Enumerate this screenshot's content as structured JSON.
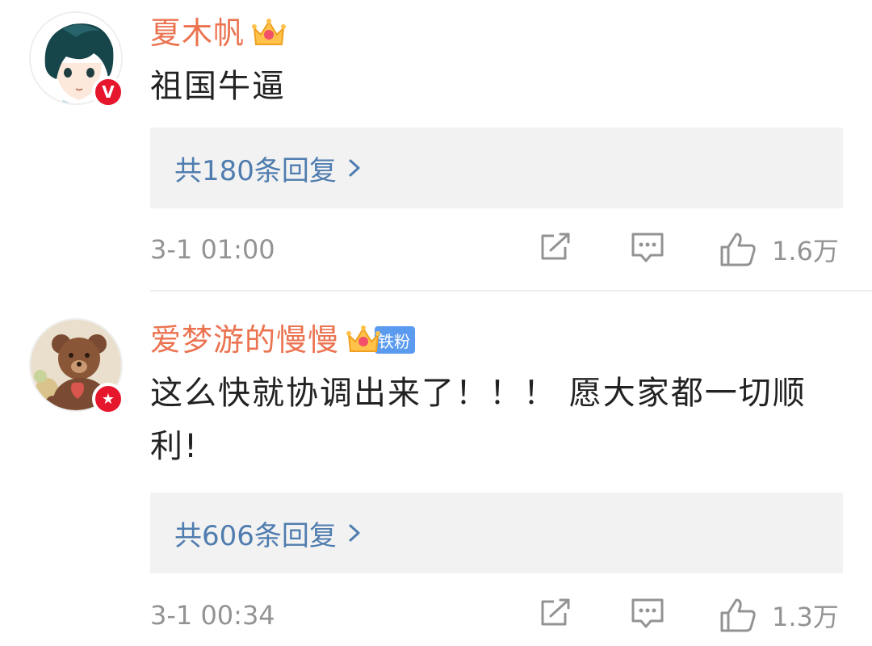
{
  "comments": [
    {
      "username": "夏木帆",
      "badge_icon": "verified-v-icon",
      "crown_icon": "crown-icon",
      "content": "祖国牛逼",
      "reply_summary": "共180条回复",
      "timestamp": "3-1 01:00",
      "like_count": "1.6万"
    },
    {
      "username": "爱梦游的慢慢",
      "badge_icon": "star-badge-icon",
      "crown_icon": "crown-icon",
      "fan_tag": "铁粉",
      "content": "这么快就协调出来了！！！ 愿大家都一切顺利!",
      "reply_summary": "共606条回复",
      "timestamp": "3-1 00:34",
      "like_count": "1.3万"
    }
  ],
  "colors": {
    "username": "#eb7350",
    "reply_link": "#507daf",
    "meta": "#939393",
    "badge_red": "#e6162d",
    "fan_tag_blue": "#5b9bef"
  }
}
